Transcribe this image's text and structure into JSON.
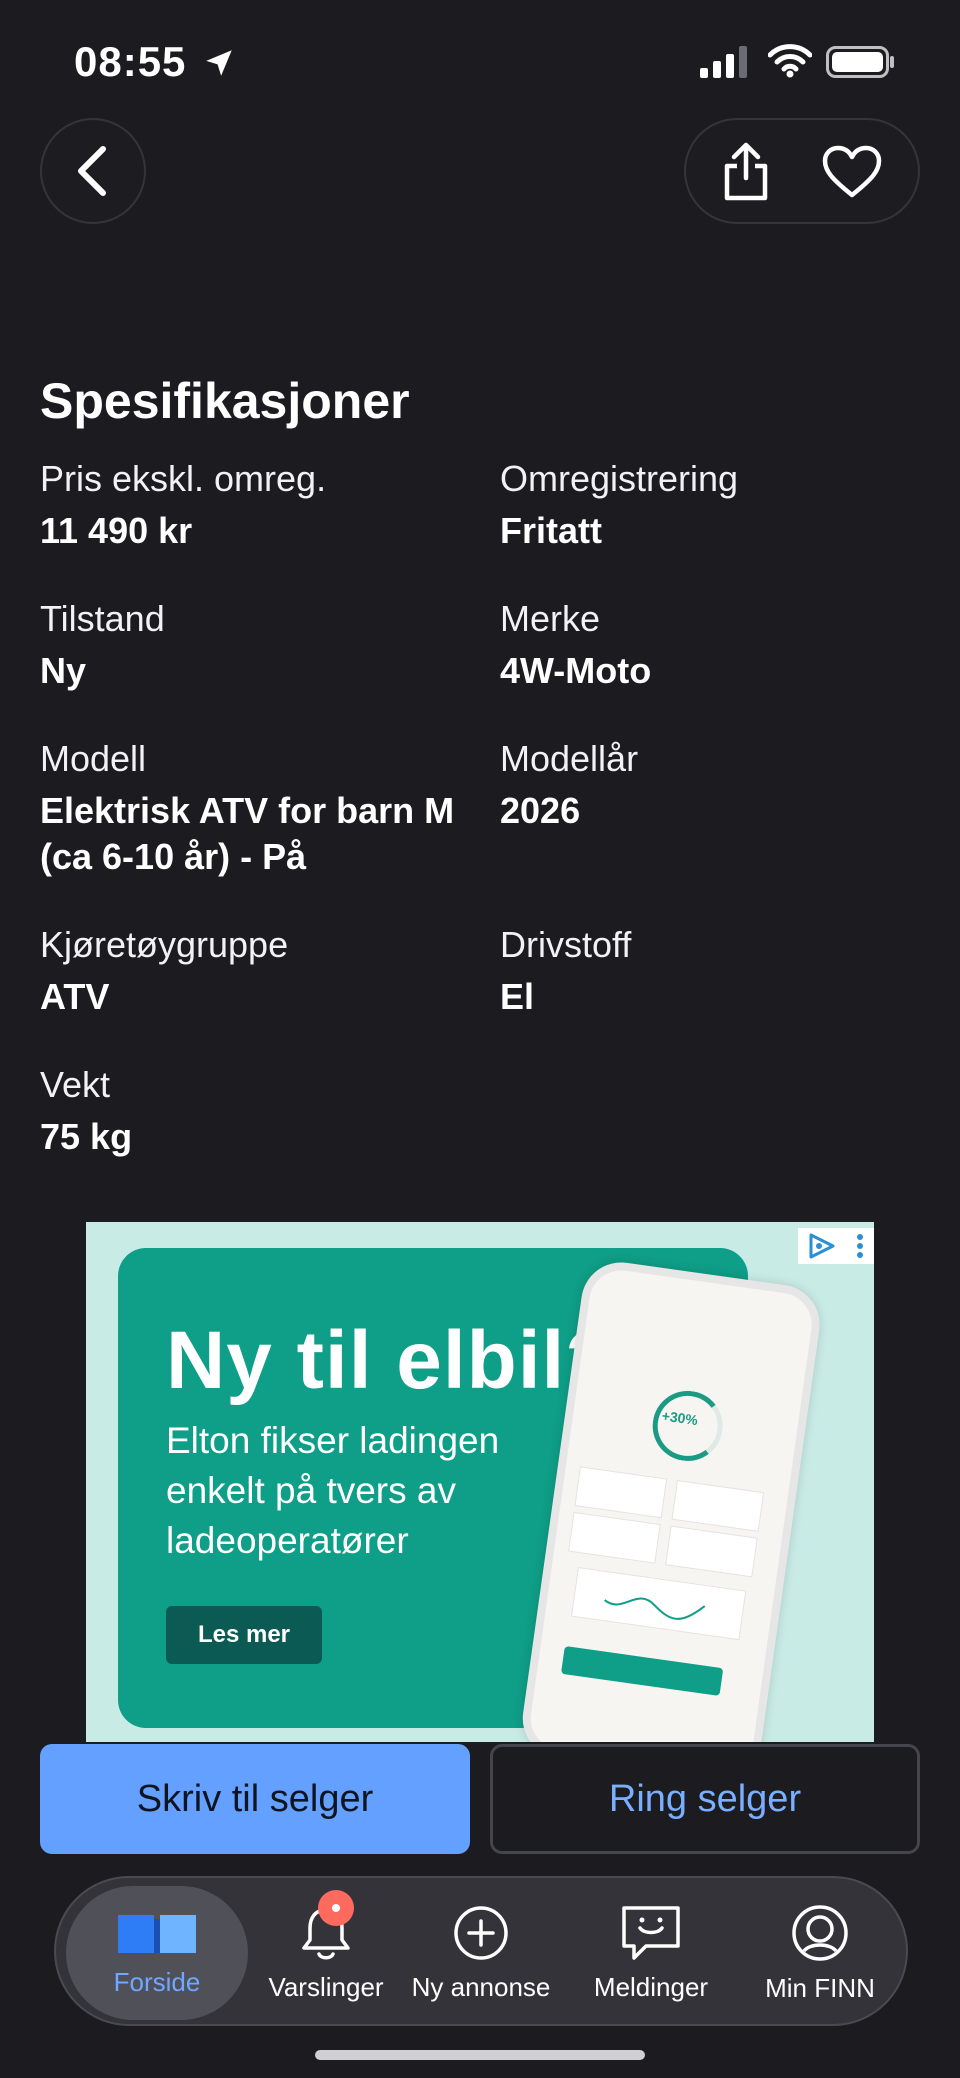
{
  "status_bar": {
    "time": "08:55"
  },
  "header": {
    "back_icon": "chevron-left-icon",
    "share_icon": "share-icon",
    "favorite_icon": "heart-icon"
  },
  "specs": {
    "title": "Spesifikasjoner",
    "items": [
      {
        "label": "Pris ekskl. omreg.",
        "value": "11 490 kr"
      },
      {
        "label": "Omregistrering",
        "value": "Fritatt"
      },
      {
        "label": "Tilstand",
        "value": "Ny"
      },
      {
        "label": "Merke",
        "value": "4W-Moto"
      },
      {
        "label": "Modell",
        "value": "Elektrisk ATV for barn M (ca 6-10 år) - På"
      },
      {
        "label": "Modellår",
        "value": "2026"
      },
      {
        "label": "Kjøretøygruppe",
        "value": "ATV"
      },
      {
        "label": "Drivstoff",
        "value": "El"
      },
      {
        "label": "Vekt",
        "value": "75 kg"
      }
    ]
  },
  "ad": {
    "headline": "Ny til elbil?",
    "body": "Elton fikser ladingen enkelt på tvers av ladeoperatører",
    "cta": "Les mer",
    "phone_badge": "+30%"
  },
  "actions": {
    "write_seller": "Skriv til selger",
    "call_seller": "Ring selger"
  },
  "tabbar": {
    "tabs": [
      {
        "label": "Forside",
        "icon": "book-icon",
        "active": true
      },
      {
        "label": "Varslinger",
        "icon": "bell-icon",
        "active": false
      },
      {
        "label": "Ny annonse",
        "icon": "plus-circle-icon",
        "active": false
      },
      {
        "label": "Meldinger",
        "icon": "chat-icon",
        "active": false
      },
      {
        "label": "Min FINN",
        "icon": "profile-icon",
        "active": false
      }
    ]
  },
  "colors": {
    "background": "#1b1b20",
    "primary_button": "#64a0ff",
    "accent_text": "#7aaeff",
    "ad_green": "#0f9e87",
    "notification": "#ff6a5f"
  }
}
